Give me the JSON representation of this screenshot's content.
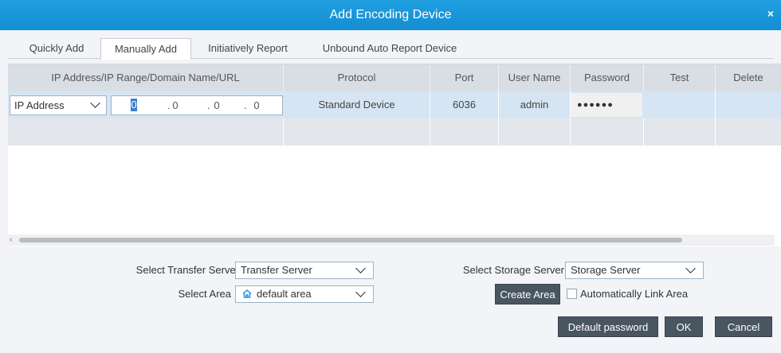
{
  "window": {
    "title": "Add Encoding Device",
    "close_glyph": "×"
  },
  "tabs": [
    {
      "label": "Quickly Add",
      "active": false
    },
    {
      "label": "Manually Add",
      "active": true
    },
    {
      "label": "Initiatively Report",
      "active": false
    },
    {
      "label": "Unbound Auto Report Device",
      "active": false
    }
  ],
  "table": {
    "columns": [
      "IP Address/IP Range/Domain Name/URL",
      "Protocol",
      "Port",
      "User Name",
      "Password",
      "Test",
      "Delete"
    ],
    "row": {
      "address_type": "IP Address",
      "ip_octets": [
        "0",
        "0",
        "0",
        "0"
      ],
      "ip_separator": ".",
      "protocol": "Standard Device",
      "port": "6036",
      "user_name": "admin",
      "password_mask": "●●●●●●"
    }
  },
  "form": {
    "transfer_server_label": "Select Transfer Server",
    "transfer_server_value": "Transfer Server",
    "area_label": "Select Area",
    "area_value": "default area",
    "storage_server_label": "Select Storage Server",
    "storage_server_value": "Storage Server",
    "create_area_label": "Create Area",
    "auto_link_label": "Automatically Link Area",
    "auto_link_checked": false
  },
  "buttons": {
    "default_password": "Default password",
    "ok": "OK",
    "cancel": "Cancel"
  },
  "icons": {
    "dropdown": "chevron-down-icon",
    "area": "home-icon",
    "scroll_left": "arrow-left-icon"
  },
  "colors": {
    "titlebar": "#1899da",
    "selected_row": "#d6e5f3",
    "button": "#4a5562"
  }
}
